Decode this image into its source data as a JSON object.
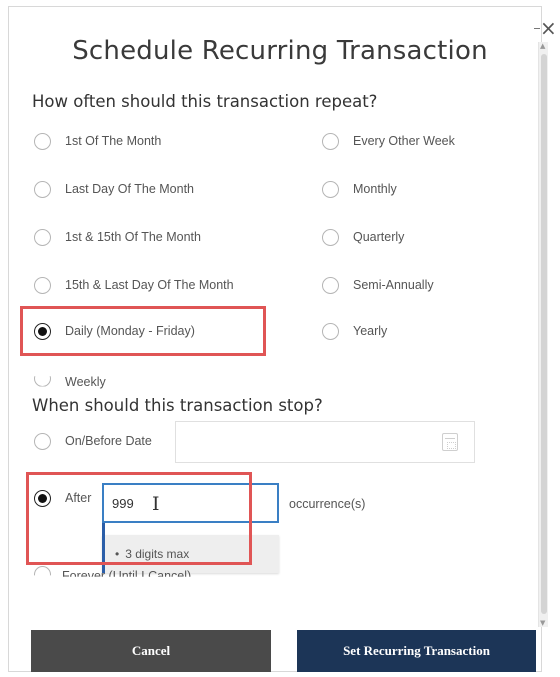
{
  "dialog": {
    "title": "Schedule Recurring Transaction",
    "close_glyph": "×"
  },
  "frequency": {
    "question": "How often should this transaction repeat?",
    "left_options": [
      {
        "label": "1st Of The Month",
        "checked": false
      },
      {
        "label": "Last Day Of The Month",
        "checked": false
      },
      {
        "label": "1st & 15th Of The Month",
        "checked": false
      },
      {
        "label": "15th & Last Day Of The Month",
        "checked": false
      },
      {
        "label": "Daily (Monday - Friday)",
        "checked": true
      },
      {
        "label": "Weekly",
        "checked": false
      }
    ],
    "right_options": [
      {
        "label": "Every Other Week",
        "checked": false
      },
      {
        "label": "Monthly",
        "checked": false
      },
      {
        "label": "Quarterly",
        "checked": false
      },
      {
        "label": "Semi-Annually",
        "checked": false
      },
      {
        "label": "Yearly",
        "checked": false
      }
    ]
  },
  "stop": {
    "question": "When should this transaction stop?",
    "on_before_date_label": "On/Before Date",
    "date_value": "",
    "after_label": "After",
    "occurrences_value": "999",
    "occurrences_suffix": "occurrence(s)",
    "tooltip_text": "3 digits max",
    "forever_label": "Forever (Until I Cancel)",
    "selected": "After"
  },
  "buttons": {
    "cancel_label": "Cancel",
    "set_label": "Set Recurring Transaction"
  },
  "colors": {
    "highlight_border": "#e05555",
    "primary_button": "#1c3557",
    "secondary_button": "#4a4a4a",
    "input_focus_border": "#3a7fc4"
  },
  "icons": {
    "calendar": "calendar-icon",
    "close": "close-icon",
    "text_cursor": "text-cursor-icon"
  }
}
